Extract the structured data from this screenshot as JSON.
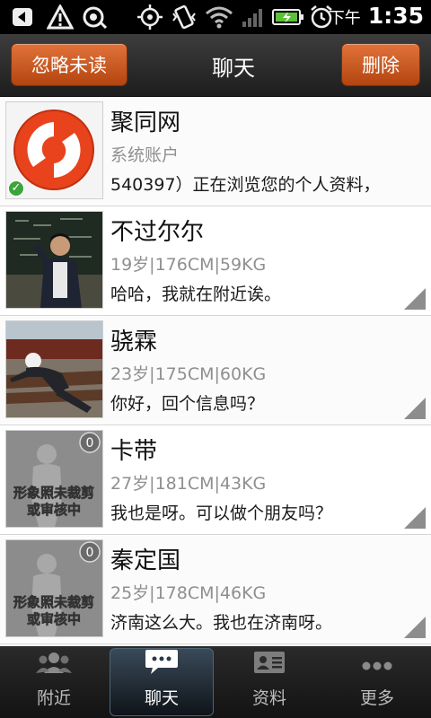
{
  "status_bar": {
    "ampm": "下午",
    "time": "1:35"
  },
  "header": {
    "left_button": "忽略未读",
    "title": "聊天",
    "right_button": "删除"
  },
  "conversations": [
    {
      "name": "聚同网",
      "sub": "系统账户",
      "message": "540397）正在浏览您的个人资料，"
    },
    {
      "name": "不过尔尔",
      "sub": "19岁|176CM|59KG",
      "message": "哈哈，我就在附近诶。"
    },
    {
      "name": "骁霖",
      "sub": "23岁|175CM|60KG",
      "message": "你好，回个信息吗？"
    },
    {
      "name": "卡带",
      "sub": "27岁|181CM|43KG",
      "message": "我也是呀。可以做个朋友吗？",
      "photo_badge": "0",
      "placeholder_text_1": "形象照未裁剪",
      "placeholder_text_2": "或审核中"
    },
    {
      "name": "秦定国",
      "sub": "25岁|178CM|46KG",
      "message": "济南这么大。我也在济南呀。",
      "photo_badge": "0",
      "placeholder_text_1": "形象照未裁剪",
      "placeholder_text_2": "或审核中"
    }
  ],
  "tabs": [
    {
      "label": "附近"
    },
    {
      "label": "聊天"
    },
    {
      "label": "资料"
    },
    {
      "label": "更多"
    }
  ],
  "colors": {
    "accent": "#c95a22",
    "active_tab": "#2b3a47"
  }
}
